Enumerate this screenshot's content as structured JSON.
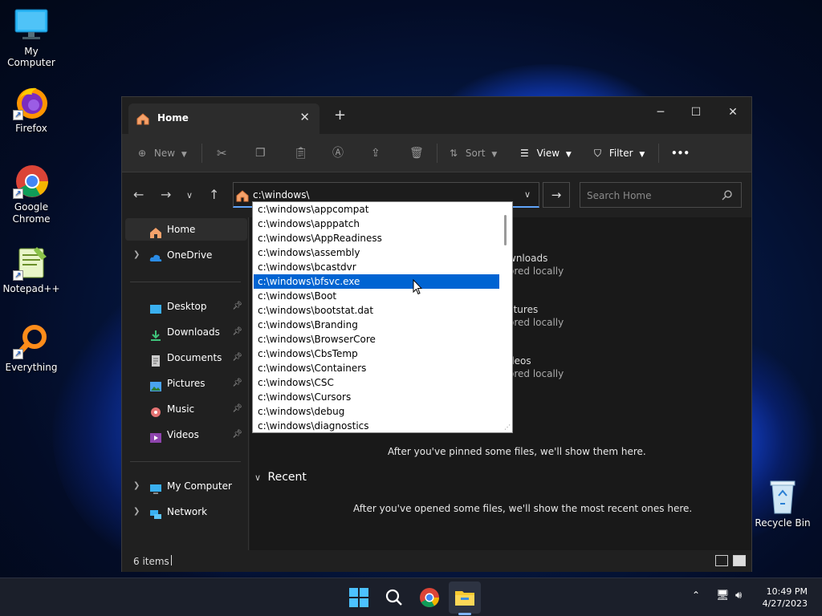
{
  "desktop": {
    "icons": [
      {
        "label": "My Computer",
        "icon": "monitor-icon"
      },
      {
        "label": "Firefox",
        "icon": "firefox-icon"
      },
      {
        "label": "Google Chrome",
        "icon": "chrome-icon"
      },
      {
        "label": "Notepad++",
        "icon": "notepadpp-icon"
      },
      {
        "label": "Everything",
        "icon": "magnifier-icon"
      },
      {
        "label": "Recycle Bin",
        "icon": "recycle-bin-icon"
      }
    ]
  },
  "window": {
    "tab_title": "Home",
    "toolbar": {
      "new_label": "New",
      "sort_label": "Sort",
      "view_label": "View",
      "filter_label": "Filter",
      "more_label": "•••"
    },
    "address": {
      "value": "c:\\windows\\"
    },
    "search": {
      "placeholder": "Search Home"
    },
    "sidebar": {
      "items": [
        {
          "label": "Home"
        },
        {
          "label": "OneDrive"
        },
        {
          "label": "Desktop"
        },
        {
          "label": "Downloads"
        },
        {
          "label": "Documents"
        },
        {
          "label": "Pictures"
        },
        {
          "label": "Music"
        },
        {
          "label": "Videos"
        },
        {
          "label": "My Computer"
        },
        {
          "label": "Network"
        }
      ]
    },
    "quick_access": [
      {
        "name_fragment": "wnloads",
        "sub": "ored locally"
      },
      {
        "name_fragment": "ctures",
        "sub": "ored locally"
      },
      {
        "name_fragment": "deos",
        "sub": "ored locally"
      }
    ],
    "favorites_empty_text": "After you've pinned some files, we'll show them here.",
    "recent_heading": "Recent",
    "recent_empty_text": "After you've opened some files, we'll show the most recent ones here.",
    "status_count": "6 items"
  },
  "autocomplete": {
    "items": [
      "c:\\windows\\appcompat",
      "c:\\windows\\apppatch",
      "c:\\windows\\AppReadiness",
      "c:\\windows\\assembly",
      "c:\\windows\\bcastdvr",
      "c:\\windows\\bfsvc.exe",
      "c:\\windows\\Boot",
      "c:\\windows\\bootstat.dat",
      "c:\\windows\\Branding",
      "c:\\windows\\BrowserCore",
      "c:\\windows\\CbsTemp",
      "c:\\windows\\Containers",
      "c:\\windows\\CSC",
      "c:\\windows\\Cursors",
      "c:\\windows\\debug",
      "c:\\windows\\diagnostics"
    ],
    "selected_index": 5
  },
  "taskbar": {
    "time": "10:49 PM",
    "date": "4/27/2023"
  }
}
